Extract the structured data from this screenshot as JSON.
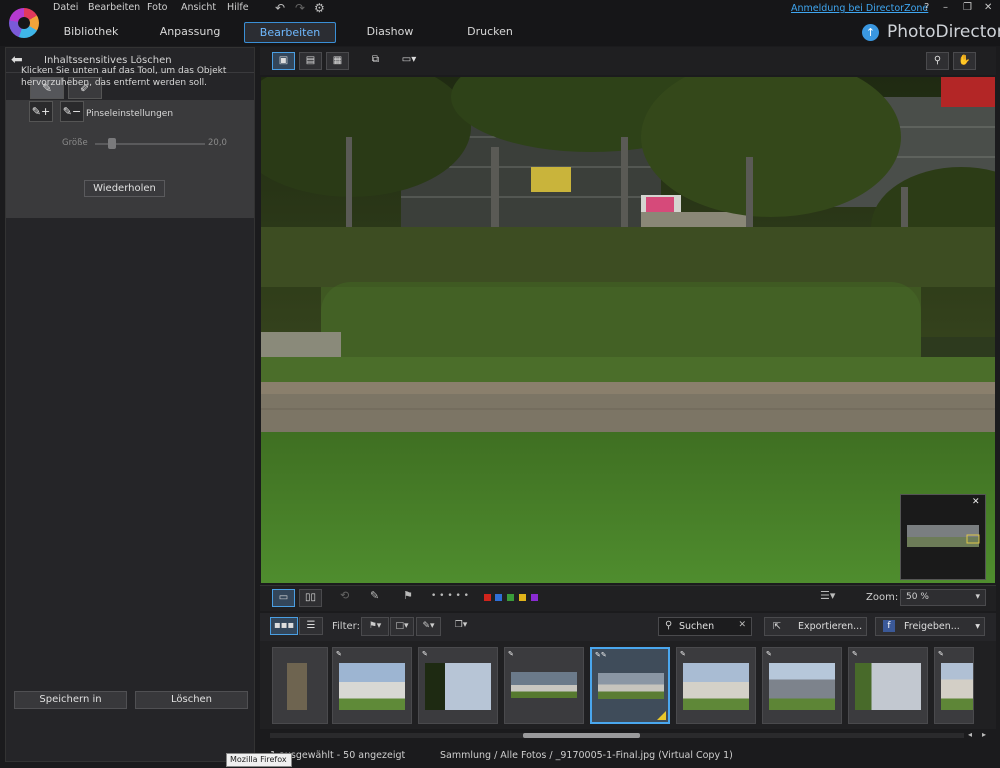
{
  "menu": {
    "file": "Datei",
    "edit": "Bearbeiten",
    "photo": "Foto",
    "view": "Ansicht",
    "help": "Hilfe"
  },
  "tabs": {
    "library": "Bibliothek",
    "adjust": "Anpassung",
    "edit": "Bearbeiten",
    "slideshow": "Diashow",
    "print": "Drucken"
  },
  "header": {
    "signin": "Anmeldung bei DirectorZone",
    "help": "?",
    "brand": "PhotoDirector"
  },
  "left_panel": {
    "title": "Inhaltssensitives Löschen",
    "instruction": "Klicken Sie unten auf das Tool, um das Objekt hervorzuheben, das entfernt werden soll.",
    "brush_settings": "Pinseleinstellungen",
    "size_label": "Größe",
    "size_value": "20,0",
    "size_level": 0.15,
    "redo": "Wiederholen",
    "save_in": "Speichern in",
    "delete": "Löschen"
  },
  "bottom_toolbar": {
    "zoom_label": "Zoom:",
    "zoom_value": "50 %",
    "rating_dots": "• • • • •",
    "color_labels": [
      "#d0241c",
      "#2f6fd6",
      "#3a9b3a",
      "#e1b31a",
      "#8a2bd2"
    ]
  },
  "filter_bar": {
    "filter_label": "Filter:",
    "search_label": "Suchen",
    "export": "Exportieren...",
    "share": "Freigeben..."
  },
  "status": {
    "left": "1 ausgewählt - 50 angezeigt",
    "path": "Sammlung / Alle Fotos / _9170005-1-Final.jpg (Virtual Copy 1)"
  },
  "tooltip": "Mozilla Firefox",
  "icons": {
    "undo": "undo-icon",
    "redo": "redo-icon",
    "settings": "gear-icon",
    "back": "back-arrow-icon",
    "search": "search-icon",
    "hand": "hand-icon",
    "close": "close-icon"
  }
}
